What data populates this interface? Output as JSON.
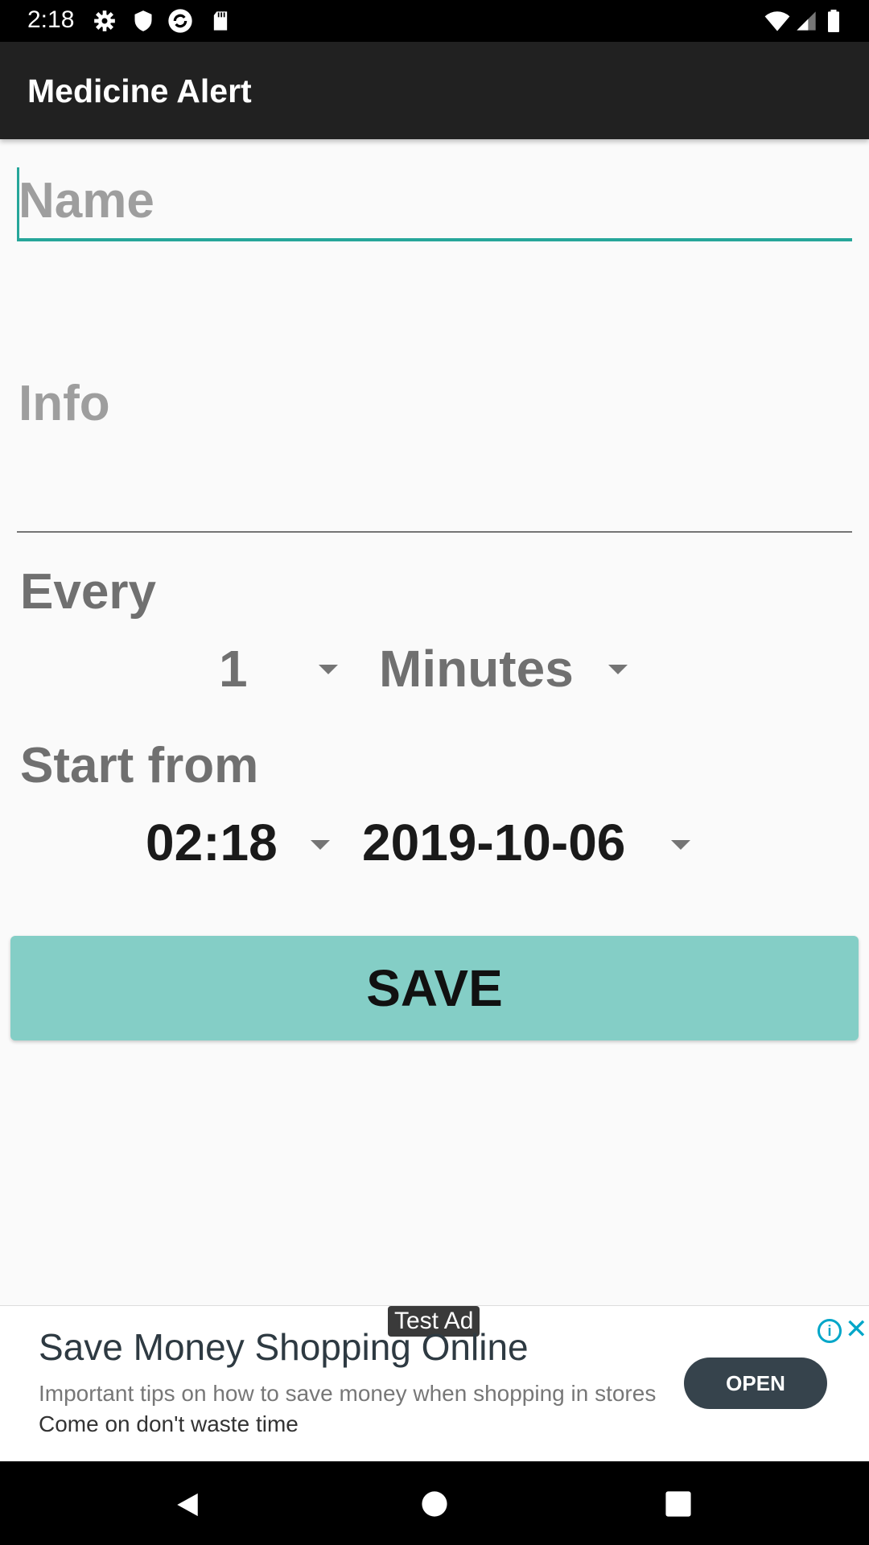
{
  "status_bar": {
    "time": "2:18",
    "icons": [
      "settings-icon",
      "shield-icon",
      "sync-icon",
      "sd-card-icon",
      "wifi-icon",
      "signal-icon",
      "battery-icon"
    ]
  },
  "app_bar": {
    "title": "Medicine Alert"
  },
  "form": {
    "name_placeholder": "Name",
    "info_placeholder": "Info",
    "every_label": "Every",
    "interval_value": "1",
    "interval_unit": "Minutes",
    "start_label": "Start from",
    "start_time": "02:18",
    "start_date": "2019-10-06",
    "save_label": "SAVE"
  },
  "ad": {
    "badge": "Test Ad",
    "title": "Save Money Shopping Online",
    "description": "Important tips on how to save money when shopping in stores",
    "description_tail": "Come on don't waste time",
    "cta": "OPEN"
  },
  "nav_bar": {
    "icons": [
      "back-icon",
      "home-icon",
      "recents-icon"
    ]
  },
  "colors": {
    "accent": "#26a69a",
    "save_button": "#84cec6",
    "app_bar": "#212121",
    "ad_button": "#36434c"
  }
}
